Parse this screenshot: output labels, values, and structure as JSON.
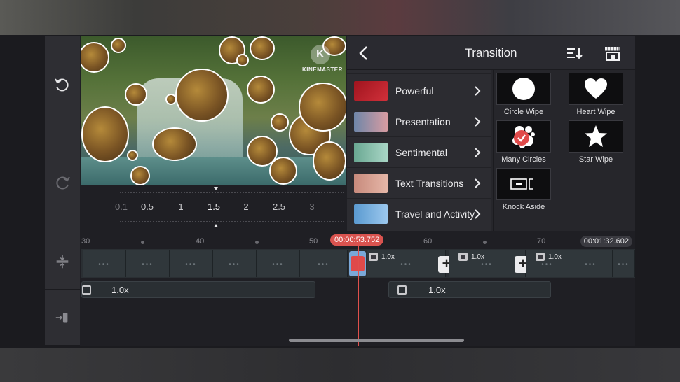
{
  "preview": {
    "watermark": "KINEMASTER"
  },
  "speed_scale": {
    "labels": [
      "0.1",
      "0.5",
      "1",
      "1.5",
      "2",
      "2.5",
      "3"
    ],
    "selected": "1.5"
  },
  "panel": {
    "title": "Transition",
    "back_icon": "chevron-left-icon",
    "sort_icon": "sort-icon",
    "store_icon": "store-icon",
    "categories": [
      {
        "label": "Powerful"
      },
      {
        "label": "Presentation"
      },
      {
        "label": "Sentimental"
      },
      {
        "label": "Text Transitions"
      },
      {
        "label": "Travel and Activity"
      }
    ],
    "transitions": [
      {
        "label": "Circle Wipe",
        "icon": "circle-icon"
      },
      {
        "label": "Heart Wipe",
        "icon": "heart-icon"
      },
      {
        "label": "Many Circles",
        "icon": "many-circles-icon",
        "selected": true
      },
      {
        "label": "Star Wipe",
        "icon": "star-icon"
      },
      {
        "label": "Knock Aside",
        "icon": "knock-aside-icon"
      }
    ]
  },
  "timeline": {
    "ruler_labels": [
      "30",
      "40",
      "50",
      "60",
      "70"
    ],
    "current_time": "00:00:53.752",
    "total_time": "00:01:32.602",
    "clip_speeds": [
      "1.0x",
      "1.0x",
      "1.0x"
    ],
    "audio_speeds": [
      "1.0x",
      "1.0x"
    ]
  },
  "colors": {
    "accent": "#d9534f",
    "panel_bg": "#26262b",
    "selected_check": "#e04a4a"
  }
}
